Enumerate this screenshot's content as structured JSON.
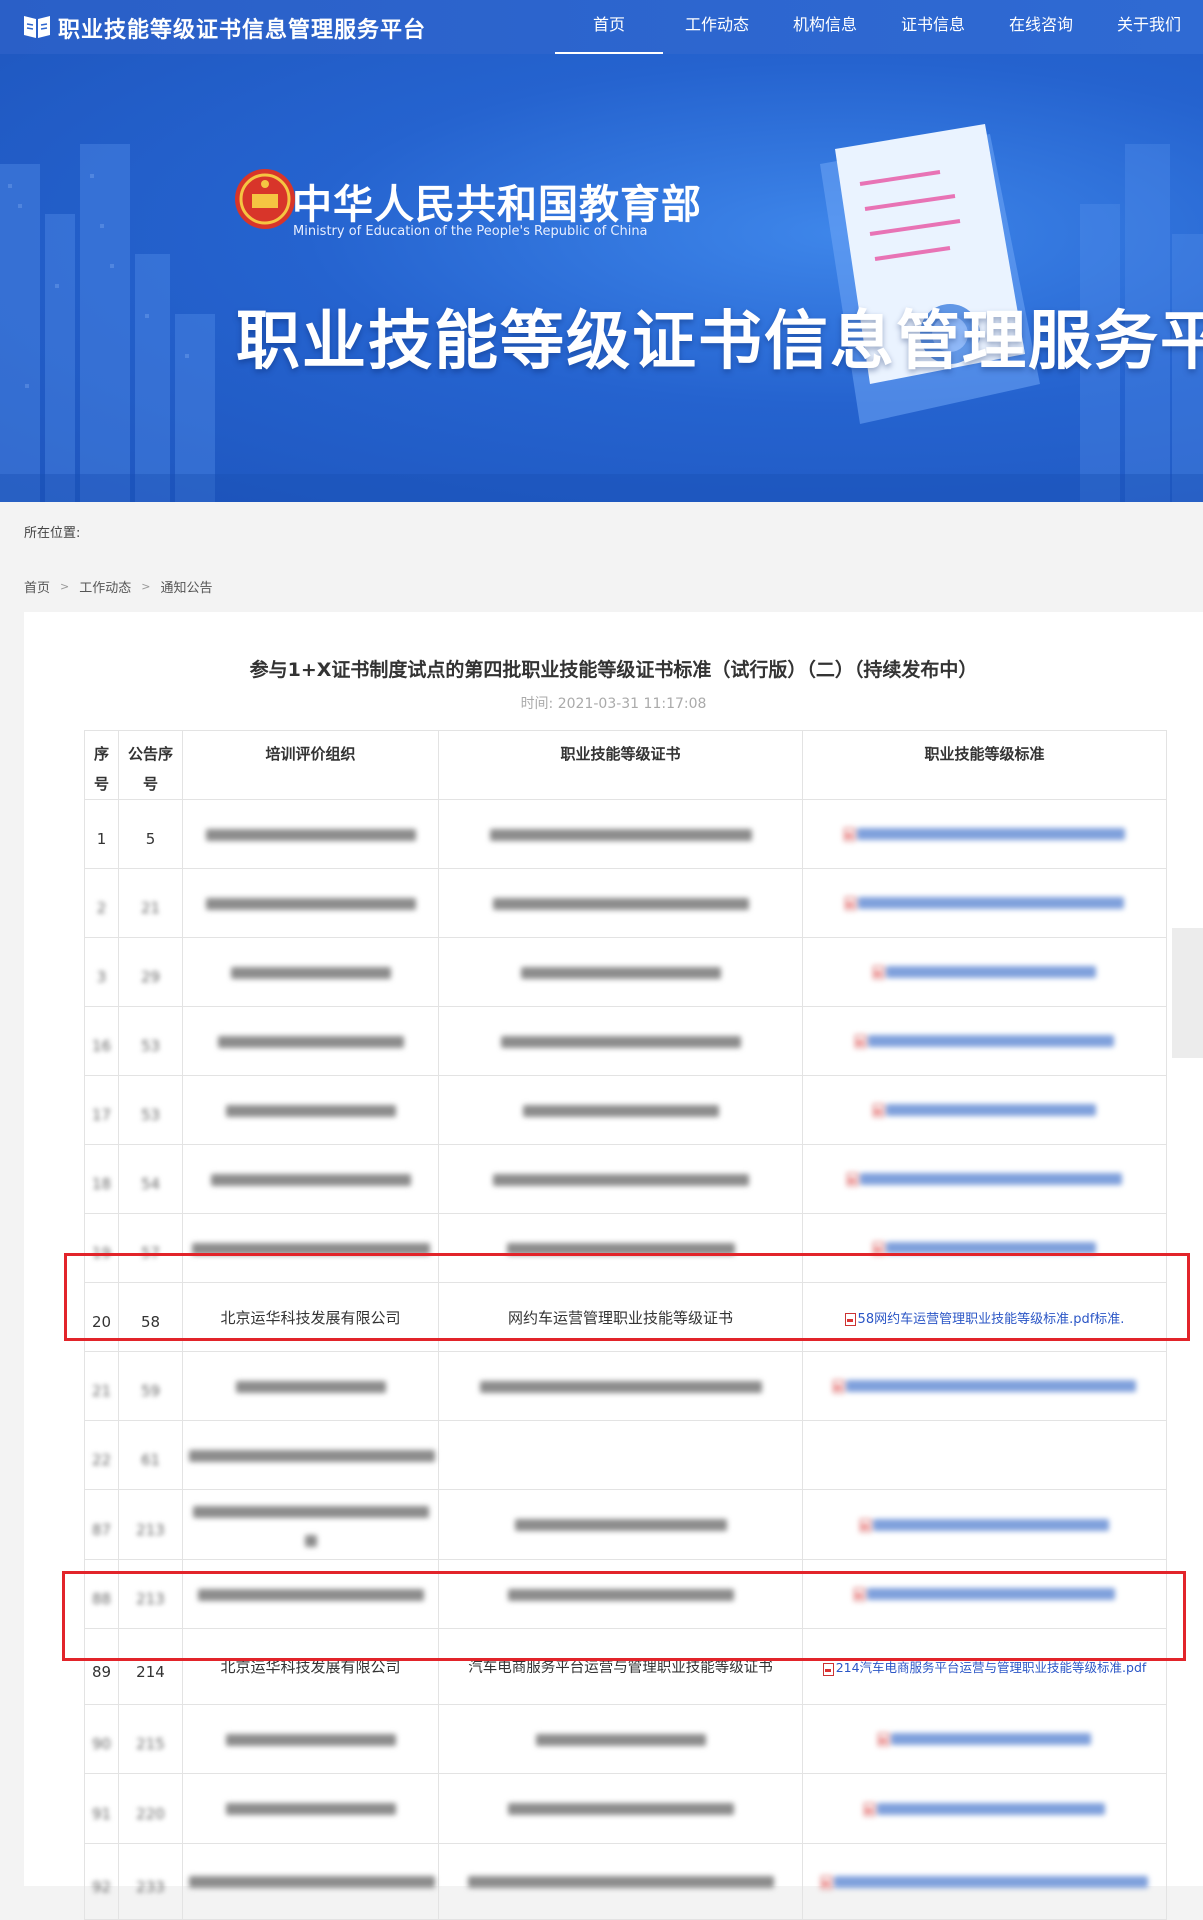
{
  "header": {
    "site_title": "职业技能等级证书信息管理服务平台",
    "nav": [
      {
        "label": "首页",
        "active": true
      },
      {
        "label": "工作动态",
        "active": false
      },
      {
        "label": "机构信息",
        "active": false
      },
      {
        "label": "证书信息",
        "active": false
      },
      {
        "label": "在线咨询",
        "active": false
      },
      {
        "label": "关于我们",
        "active": false
      }
    ]
  },
  "banner": {
    "ministry_cn": "中华人民共和国教育部",
    "ministry_en": "Ministry of Education of the People's Republic of China",
    "title": "职业技能等级证书信息管理服务平台"
  },
  "location": {
    "label": "所在位置:",
    "breadcrumb": [
      "首页",
      "工作动态",
      "通知公告"
    ]
  },
  "article": {
    "title": "参与1+X证书制度试点的第四批职业技能等级证书标准（试行版）（二）（持续发布中）",
    "time": "时间:   2021-03-31 11:17:08"
  },
  "table": {
    "headers": {
      "idx": "序号",
      "notice_no": "公告序号",
      "org": "培训评价组织",
      "cert": "职业技能等级证书",
      "std": "职业技能等级标准"
    },
    "visible_rows": [
      {
        "idx": "1",
        "notice_no": "5"
      },
      {
        "idx": "20",
        "notice_no": "58",
        "org": "北京运华科技发展有限公司",
        "cert": "网约车运营管理职业技能等级证书",
        "std": "58网约车运营管理职业技能等级标准.pdf标准."
      },
      {
        "idx": "89",
        "notice_no": "214",
        "org": "北京运华科技发展有限公司",
        "cert": "汽车电商服务平台运营与管理职业技能等级证书",
        "std": "214汽车电商服务平台运营与管理职业技能等级标准.pdf"
      }
    ],
    "blurred_rows": [
      {
        "idx": "2",
        "no": "21"
      },
      {
        "idx": "3",
        "no": "29"
      },
      {
        "idx": "16",
        "no": "53"
      },
      {
        "idx": "17",
        "no": "53"
      },
      {
        "idx": "18",
        "no": "54"
      },
      {
        "idx": "19",
        "no": "57"
      },
      {
        "idx": "21",
        "no": "59"
      },
      {
        "idx": "22",
        "no": "61"
      },
      {
        "idx": "87",
        "no": "213"
      },
      {
        "idx": "88",
        "no": "213"
      },
      {
        "idx": "90",
        "no": "215"
      },
      {
        "idx": "91",
        "no": "220"
      },
      {
        "idx": "92",
        "no": "233"
      }
    ]
  },
  "colors": {
    "nav_bg": "#2d66cf",
    "link": "#2b56c6",
    "highlight": "#e2242a"
  }
}
